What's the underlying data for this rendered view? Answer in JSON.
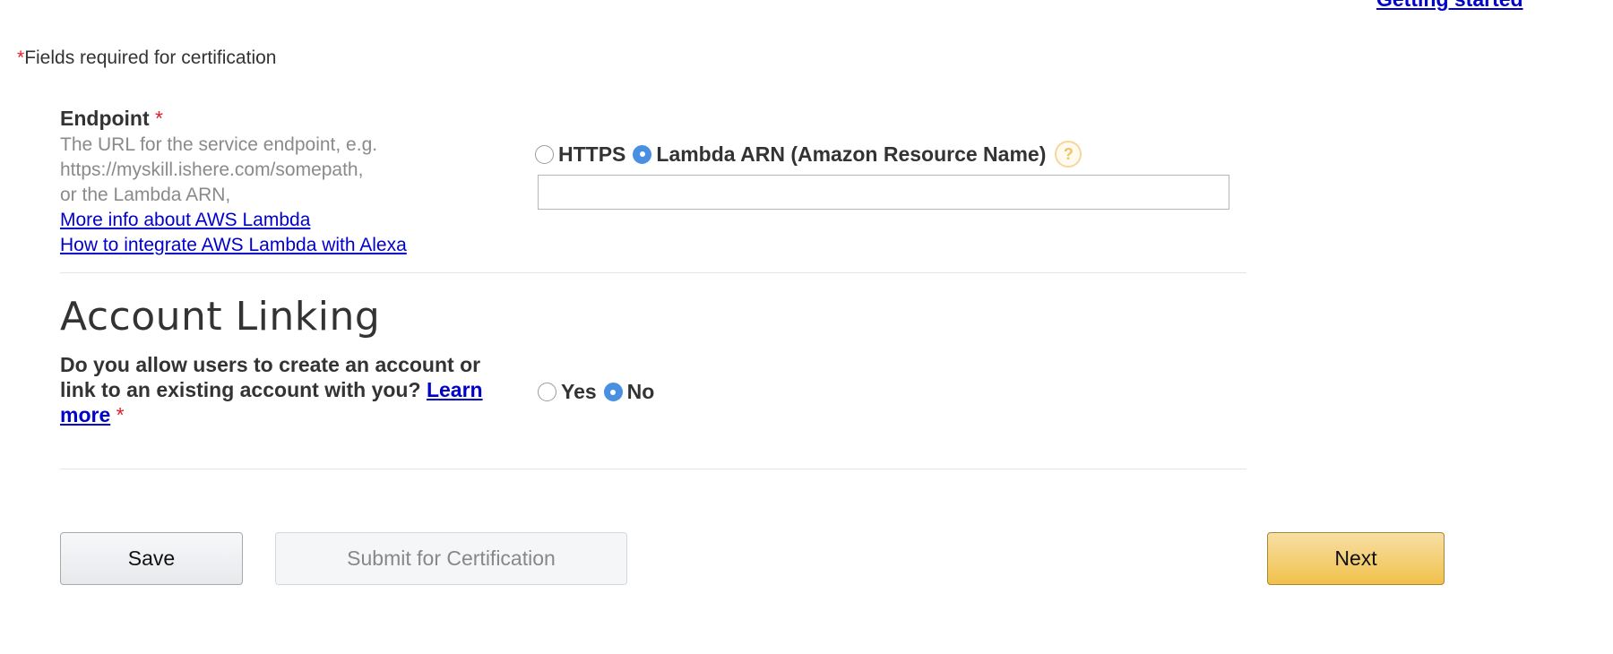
{
  "header": {
    "getting_started_link": "Getting started"
  },
  "required_note": {
    "star": "*",
    "text": "Fields required for certification"
  },
  "endpoint": {
    "label": "Endpoint",
    "required_star": "*",
    "help_lines": [
      "The URL for the service endpoint, e.g.",
      "https://myskill.ishere.com/somepath,",
      "or the Lambda ARN,"
    ],
    "links": [
      "More info about AWS Lambda",
      "How to integrate AWS Lambda with Alexa"
    ],
    "options": [
      {
        "label": "HTTPS",
        "selected": false
      },
      {
        "label": "Lambda ARN (Amazon Resource Name)",
        "selected": true
      }
    ],
    "help_icon": "question-mark-icon",
    "help_icon_glyph": "?",
    "arn_value": "",
    "arn_placeholder": ""
  },
  "account_linking": {
    "heading": "Account Linking",
    "question": "Do you allow users to create an account or link to an existing account with you?",
    "learn_more": "Learn more",
    "required_star": "*",
    "options": [
      {
        "label": "Yes",
        "selected": false
      },
      {
        "label": "No",
        "selected": true
      }
    ]
  },
  "buttons": {
    "save": "Save",
    "submit": "Submit for Certification",
    "next": "Next"
  },
  "colors": {
    "link": "#0000cc",
    "required": "#e0202a",
    "radio_selected": "#4a90e2",
    "next_button": "#f0c14b"
  }
}
